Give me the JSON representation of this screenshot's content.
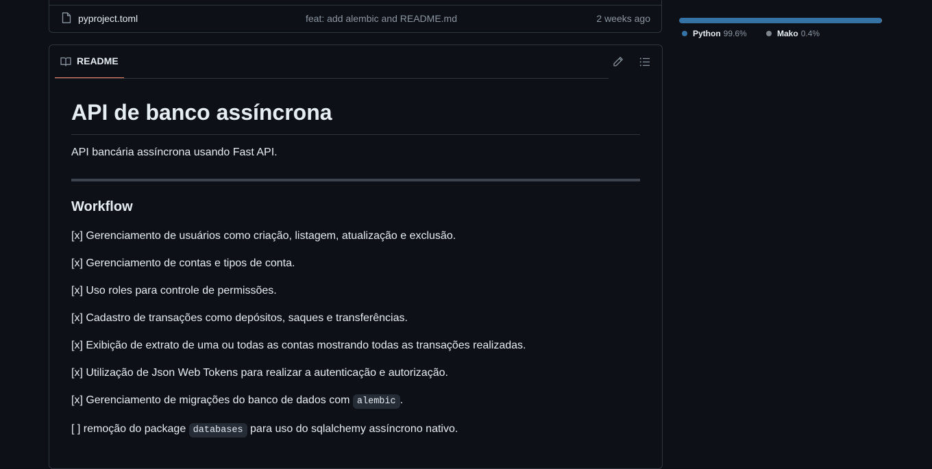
{
  "file_row": {
    "name": "pyproject.toml",
    "commit_message": "feat: add alembic and README.md",
    "date": "2 weeks ago",
    "icon": "file-icon"
  },
  "readme": {
    "tab_label": "README",
    "title": "API de banco assíncrona",
    "intro": "API bancária assíncrona usando Fast API.",
    "workflow_heading": "Workflow",
    "items": [
      "[x] Gerenciamento de usuários como criação, listagem, atualização e exclusão.",
      "[x] Gerenciamento de contas e tipos de conta.",
      "[x] Uso roles para controle de permissões.",
      "[x] Cadastro de transações como depósitos, saques e transferências.",
      "[x] Exibição de extrato de uma ou todas as contas mostrando todas as transações realizadas.",
      "[x] Utilização de Json Web Tokens para realizar a autenticação e autorização."
    ],
    "item_alembic": {
      "before": "[x] Gerenciamento de migrações do banco de dados com ",
      "code": "alembic",
      "after": "."
    },
    "item_databases": {
      "before": "[ ] remoção do package ",
      "code": "databases",
      "after": " para uso do sqlalchemy assíncrono nativo."
    }
  },
  "languages": [
    {
      "name": "Python",
      "percent": "99.6%",
      "value": 99.6,
      "color": "#3572A5"
    },
    {
      "name": "Mako",
      "percent": "0.4%",
      "value": 0.4,
      "color": "#7e858d"
    }
  ]
}
